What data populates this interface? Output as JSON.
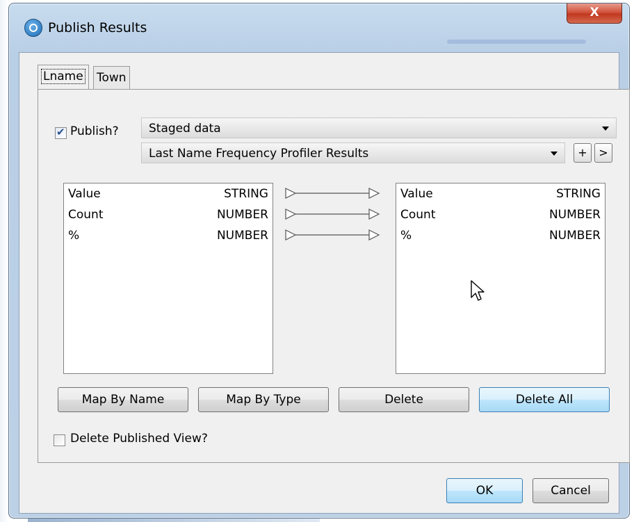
{
  "window": {
    "title": "Publish Results",
    "close_label": "X"
  },
  "tabs": [
    {
      "label": "Lname",
      "active": true
    },
    {
      "label": "Town",
      "active": false
    }
  ],
  "publish": {
    "label": "Publish?",
    "checked": true,
    "target_select": "Staged data",
    "name_select": "Last Name Frequency Profiler Results",
    "add_label": "+",
    "next_label": ">"
  },
  "source_columns": [
    {
      "name": "Value",
      "type": "STRING"
    },
    {
      "name": "Count",
      "type": "NUMBER"
    },
    {
      "name": "%",
      "type": "NUMBER"
    }
  ],
  "target_columns": [
    {
      "name": "Value",
      "type": "STRING"
    },
    {
      "name": "Count",
      "type": "NUMBER"
    },
    {
      "name": "%",
      "type": "NUMBER"
    }
  ],
  "actions": {
    "map_by_name": "Map By Name",
    "map_by_type": "Map By Type",
    "delete": "Delete",
    "delete_all": "Delete All"
  },
  "delete_view": {
    "label": "Delete Published View?",
    "checked": false
  },
  "footer": {
    "ok": "OK",
    "cancel": "Cancel"
  },
  "icons": {
    "app": "app-logo-icon",
    "close": "close-icon",
    "dropdown": "chevron-down-icon",
    "mapping": "arrow-right-icon",
    "cursor": "mouse-pointer-icon"
  },
  "colors": {
    "title_bar": "#bcd0e6",
    "close_button": "#c0381f",
    "hot_button": "#bee6fd",
    "dialog_bg": "#f0f0f0"
  }
}
